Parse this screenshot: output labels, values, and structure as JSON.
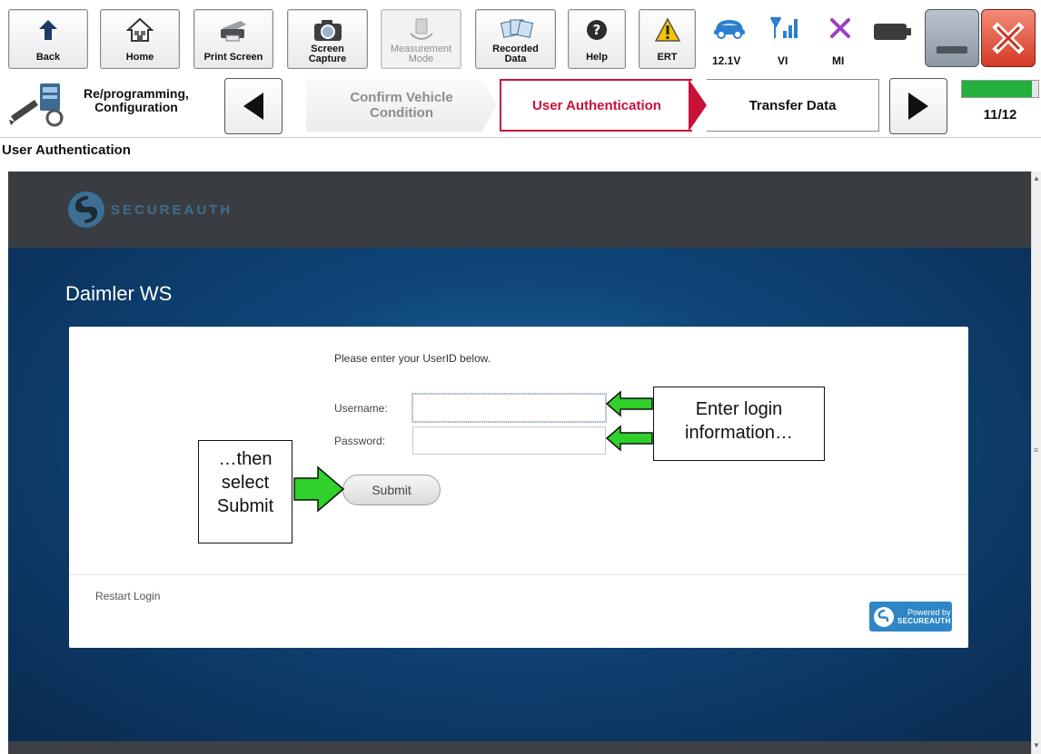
{
  "toolbar": {
    "buttons": [
      {
        "label": "Back",
        "icon": "back-arrow-icon"
      },
      {
        "label": "Home",
        "icon": "home-icon"
      },
      {
        "label": "Print Screen",
        "icon": "printer-icon"
      },
      {
        "label_line1": "Screen",
        "label_line2": "Capture",
        "icon": "camera-icon"
      },
      {
        "label_line1": "Measurement",
        "label_line2": "Mode",
        "icon": "measurement-icon",
        "disabled": true
      },
      {
        "label_line1": "Recorded",
        "label_line2": "Data",
        "icon": "recorded-data-icon"
      },
      {
        "label": "Help",
        "icon": "help-icon"
      },
      {
        "label": "ERT",
        "icon": "warning-icon"
      }
    ],
    "status": {
      "voltage": "12.1V",
      "vi": "VI",
      "mi": "MI"
    }
  },
  "stepbar": {
    "mode_line1": "Re/programming,",
    "mode_line2": "Configuration",
    "prev_step_line1": "Confirm Vehicle",
    "prev_step_line2": "Condition",
    "current_step": "User Authentication",
    "next_step": "Transfer Data",
    "progress_text": "11/12",
    "progress_fraction": 0.9167
  },
  "page": {
    "title": "User Authentication"
  },
  "secureauth": {
    "logo_text": "SECUREAUTH",
    "company_name": "Daimler WS",
    "instruction": "Please enter your UserID below.",
    "username_label": "Username:",
    "password_label": "Password:",
    "username_value": "",
    "password_value": "",
    "submit_label": "Submit",
    "restart_label": "Restart Login",
    "powered_line1": "Powered by",
    "powered_line2": "SECUREAUTH"
  },
  "callouts": {
    "login_line1": "Enter login",
    "login_line2": "information…",
    "submit_line1": "…then",
    "submit_line2": "select",
    "submit_line3": "Submit"
  },
  "colors": {
    "current_step_accent": "#c8123a",
    "progress_green": "#23b03c",
    "callout_arrow_green": "#2fd12a",
    "secureauth_header": "#393d41",
    "secureauth_blue": "#0f4679"
  }
}
